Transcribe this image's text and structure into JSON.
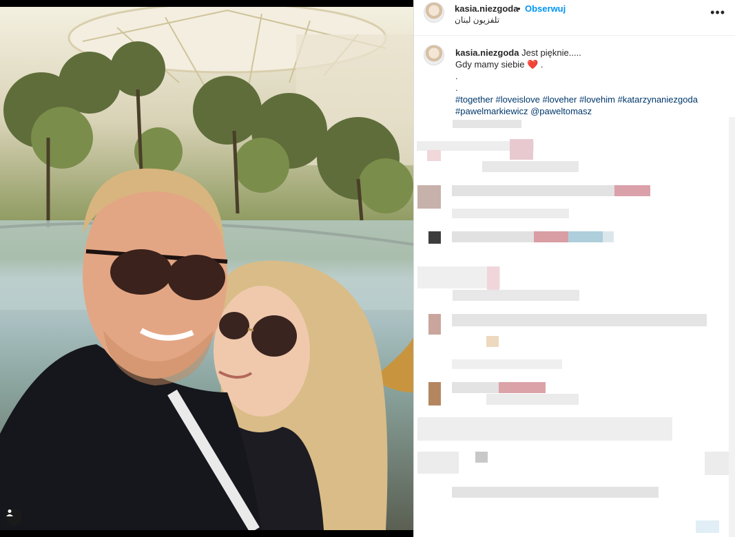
{
  "post": {
    "username": "kasia.niezgoda",
    "separator": "•",
    "follow_label": "Obserwuj",
    "location": "تلفزيون لبنان",
    "more_icon": "more-horizontal-icon"
  },
  "caption": {
    "username": "kasia.niezgoda",
    "text": " Jest pięknie.....",
    "line2": "Gdy mamy siebie",
    "heart": "❤️",
    "line2_end": " .",
    "dot1": ".",
    "dot2": ".",
    "hashtags_line1": "#together #loveislove #loveher #lovehim #katarzynaniezgoda",
    "hashtags_line2": "#pawelmarkiewicz @paweltomasz"
  },
  "colors": {
    "follow_blue": "#0095f6",
    "hashtag_blue": "#00376b",
    "heart_red": "#ed4956"
  }
}
